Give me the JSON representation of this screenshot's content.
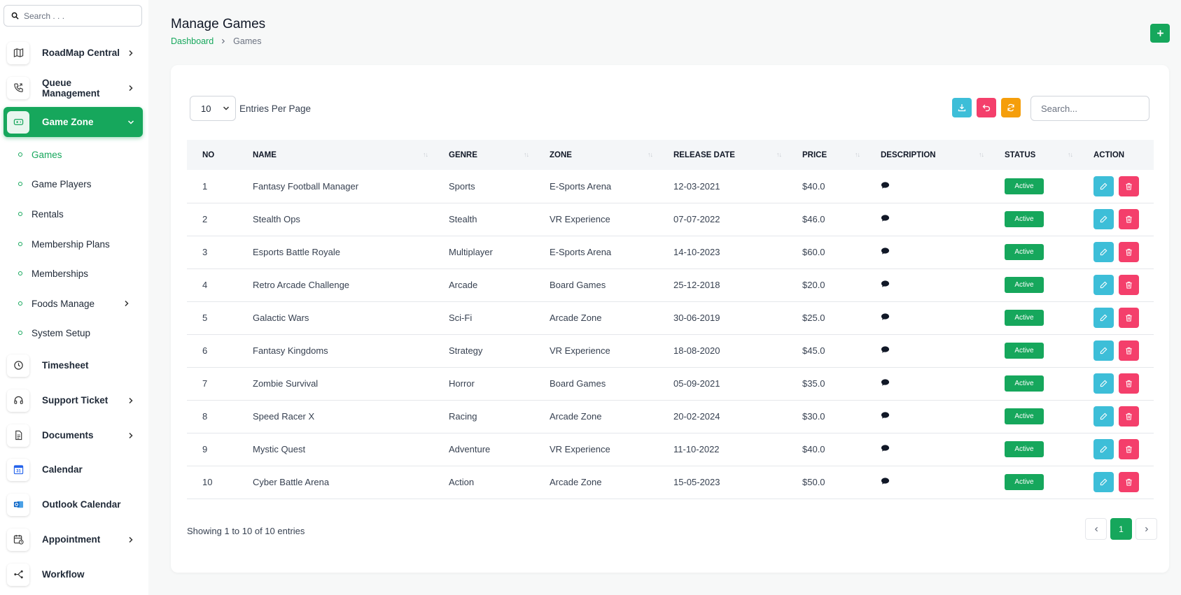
{
  "sidebar": {
    "search_placeholder": "Search . . .",
    "items": [
      {
        "label": "RoadMap Central"
      },
      {
        "label": "Queue Management"
      },
      {
        "label": "Game Zone"
      },
      {
        "label": "Timesheet"
      },
      {
        "label": "Support Ticket"
      },
      {
        "label": "Documents"
      },
      {
        "label": "Calendar"
      },
      {
        "label": "Outlook Calendar"
      },
      {
        "label": "Appointment"
      },
      {
        "label": "Workflow"
      }
    ],
    "sub_items": [
      {
        "label": "Games"
      },
      {
        "label": "Game Players"
      },
      {
        "label": "Rentals"
      },
      {
        "label": "Membership Plans"
      },
      {
        "label": "Memberships"
      },
      {
        "label": "Foods Manage"
      },
      {
        "label": "System Setup"
      }
    ]
  },
  "header": {
    "title": "Manage Games",
    "breadcrumb_home": "Dashboard",
    "breadcrumb_current": "Games"
  },
  "toolbar": {
    "entries_value": "10",
    "entries_label": "Entries Per Page",
    "search_placeholder": "Search..."
  },
  "table": {
    "columns": [
      "NO",
      "NAME",
      "GENRE",
      "ZONE",
      "RELEASE DATE",
      "PRICE",
      "DESCRIPTION",
      "STATUS",
      "ACTION"
    ],
    "rows": [
      {
        "no": "1",
        "name": "Fantasy Football Manager",
        "genre": "Sports",
        "zone": "E-Sports Arena",
        "date": "12-03-2021",
        "price": "$40.0",
        "status": "Active"
      },
      {
        "no": "2",
        "name": "Stealth Ops",
        "genre": "Stealth",
        "zone": "VR Experience",
        "date": "07-07-2022",
        "price": "$46.0",
        "status": "Active"
      },
      {
        "no": "3",
        "name": "Esports Battle Royale",
        "genre": "Multiplayer",
        "zone": "E-Sports Arena",
        "date": "14-10-2023",
        "price": "$60.0",
        "status": "Active"
      },
      {
        "no": "4",
        "name": "Retro Arcade Challenge",
        "genre": "Arcade",
        "zone": "Board Games",
        "date": "25-12-2018",
        "price": "$20.0",
        "status": "Active"
      },
      {
        "no": "5",
        "name": "Galactic Wars",
        "genre": "Sci-Fi",
        "zone": "Arcade Zone",
        "date": "30-06-2019",
        "price": "$25.0",
        "status": "Active"
      },
      {
        "no": "6",
        "name": "Fantasy Kingdoms",
        "genre": "Strategy",
        "zone": "VR Experience",
        "date": "18-08-2020",
        "price": "$45.0",
        "status": "Active"
      },
      {
        "no": "7",
        "name": "Zombie Survival",
        "genre": "Horror",
        "zone": "Board Games",
        "date": "05-09-2021",
        "price": "$35.0",
        "status": "Active"
      },
      {
        "no": "8",
        "name": "Speed Racer X",
        "genre": "Racing",
        "zone": "Arcade Zone",
        "date": "20-02-2024",
        "price": "$30.0",
        "status": "Active"
      },
      {
        "no": "9",
        "name": "Mystic Quest",
        "genre": "Adventure",
        "zone": "VR Experience",
        "date": "11-10-2022",
        "price": "$40.0",
        "status": "Active"
      },
      {
        "no": "10",
        "name": "Cyber Battle Arena",
        "genre": "Action",
        "zone": "Arcade Zone",
        "date": "15-05-2023",
        "price": "$50.0",
        "status": "Active"
      }
    ]
  },
  "footer": {
    "showing": "Showing 1 to 10 of 10 entries",
    "current_page": "1"
  },
  "colors": {
    "accent": "#16a75c",
    "edit": "#3dbed8",
    "delete": "#f43f6b",
    "refresh": "#f59e0b"
  }
}
